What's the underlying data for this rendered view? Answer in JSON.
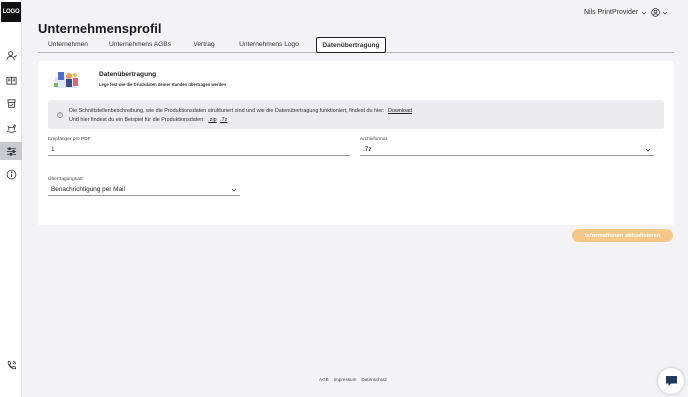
{
  "sidebar": {
    "logo": "LOGO",
    "items": [
      {
        "icon": "users-icon"
      },
      {
        "icon": "book-icon"
      },
      {
        "icon": "cup-icon"
      },
      {
        "icon": "rocking-horse-icon"
      },
      {
        "icon": "sliders-icon",
        "active": true
      },
      {
        "icon": "info-icon"
      }
    ],
    "bottom_icon": "phone-icon"
  },
  "topbar": {
    "user_name": "Nils PrintProvider"
  },
  "page": {
    "title": "Unternehmensprofil"
  },
  "tabs": [
    {
      "label": "Unternehmen"
    },
    {
      "label": "Unternehmens AGBs"
    },
    {
      "label": "Vertrag"
    },
    {
      "label": "Unternehmens Logo"
    },
    {
      "label": "Datenübertragung",
      "active": true
    }
  ],
  "section": {
    "title": "Datenübertragung",
    "subtitle": "Lege fest wie die Druckdaten deiner Kunden übertragen werden"
  },
  "info": {
    "line1_text": "Die Schnittstellenbeschreibung, wie die Produktionsdaten strukturiert sind und wie die Datenübertragung funktioniert, findest du hier:",
    "line1_link": "Download",
    "line2_text": "Und hier findest du ein Beispiel für die Produktionsdaten:",
    "line2_link_zip": ".zip",
    "line2_link_7z": ".7z"
  },
  "form": {
    "recipients_label": "Empfänger pro PDF",
    "recipients_value": "1",
    "archive_label": "Archivformat",
    "archive_value": ".7z",
    "transfer_label": "Übertragungsart",
    "transfer_value": "Benachrichtigung per Mail"
  },
  "actions": {
    "update_label": "Informationen aktualisieren",
    "update_color": "#f5c88a"
  },
  "footer": {
    "links": [
      "AGB",
      "Impressum",
      "Datenschutz"
    ]
  }
}
